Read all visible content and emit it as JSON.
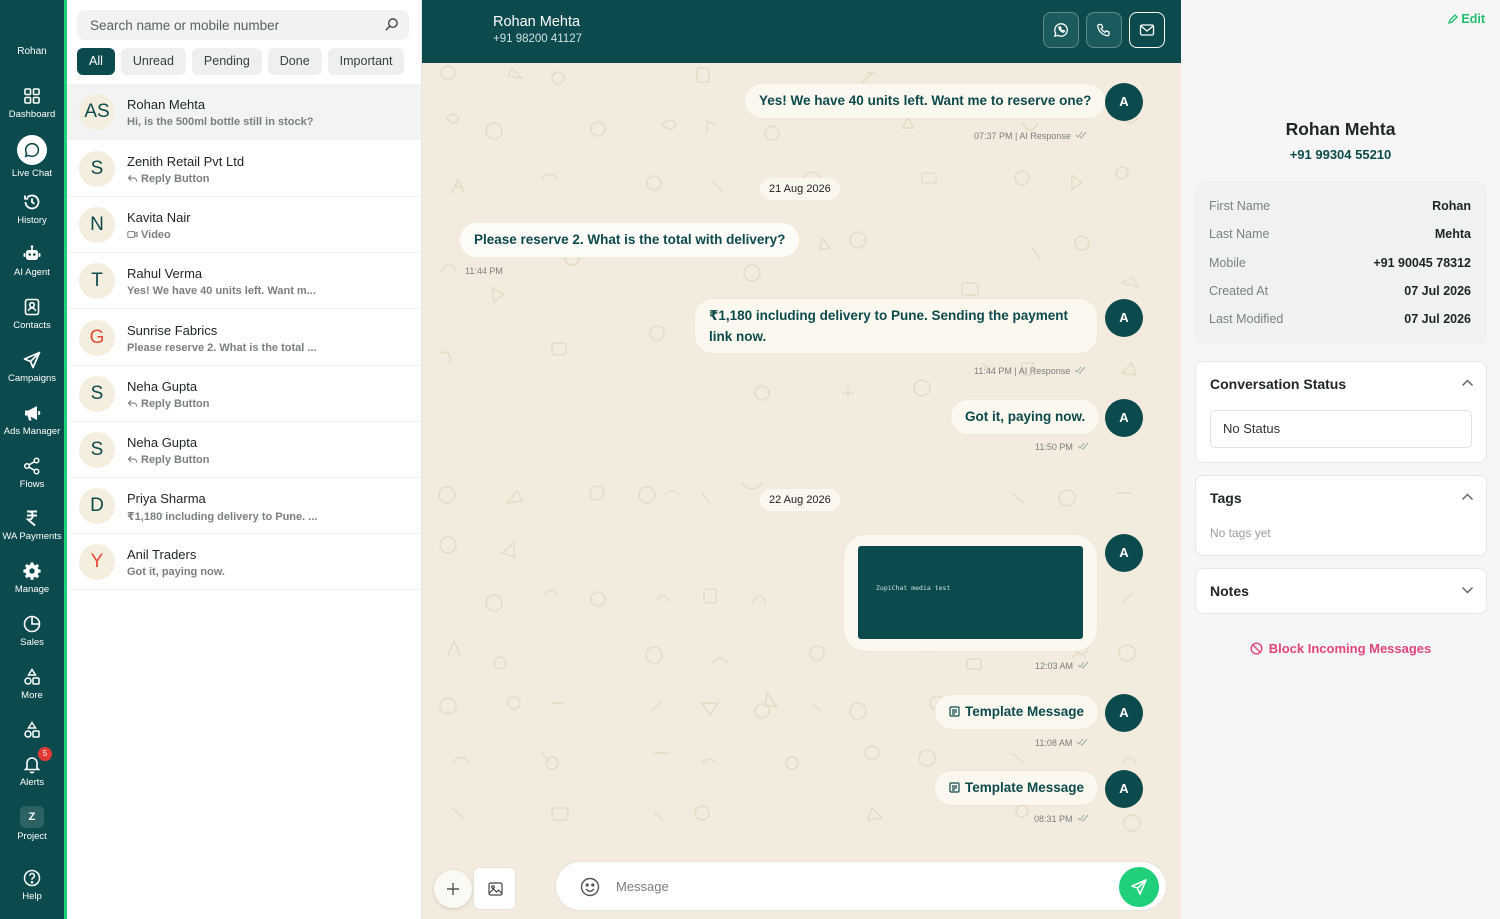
{
  "nav": {
    "user": "Rohan",
    "items": [
      {
        "label": "Dashboard",
        "icon": "dashboard-icon"
      },
      {
        "label": "Live Chat",
        "icon": "chat-icon"
      },
      {
        "label": "History",
        "icon": "history-icon"
      },
      {
        "label": "AI Agent",
        "icon": "robot-icon"
      },
      {
        "label": "Contacts",
        "icon": "contacts-icon"
      },
      {
        "label": "Campaigns",
        "icon": "send-icon"
      },
      {
        "label": "Ads Manager",
        "icon": "megaphone-icon"
      },
      {
        "label": "Flows",
        "icon": "share-icon"
      },
      {
        "label": "WA Payments",
        "icon": "rupee-icon"
      },
      {
        "label": "Manage",
        "icon": "gear-icon"
      },
      {
        "label": "Sales",
        "icon": "pie-icon"
      },
      {
        "label": "More",
        "icon": "shapes-icon"
      },
      {
        "label": "Alerts",
        "icon": "bell-icon"
      },
      {
        "label": "Project",
        "icon": "project-icon"
      },
      {
        "label": "Help",
        "icon": "help-icon"
      }
    ],
    "alerts_badge": "5",
    "project_letter": "Z"
  },
  "list": {
    "search_placeholder": "Search name or mobile number",
    "filters": [
      "All",
      "Unread",
      "Pending",
      "Done",
      "Important"
    ],
    "conversations": [
      {
        "avatar": "AS",
        "name": "Rohan Mehta",
        "preview": "Hi, is the 500ml bottle still in stock?"
      },
      {
        "avatar": "S",
        "name": "Zenith Retail Pvt Ltd",
        "preview": "Reply Button"
      },
      {
        "avatar": "N",
        "name": "Kavita Nair",
        "preview": "Video"
      },
      {
        "avatar": "T",
        "name": "Rahul Verma",
        "preview": "Yes! We have 40 units left. Want m..."
      },
      {
        "avatar": "G",
        "name": "Sunrise Fabrics",
        "preview": "Please reserve 2. What is the total ..."
      },
      {
        "avatar": "S",
        "name": "Neha Gupta",
        "preview": "Reply Button"
      },
      {
        "avatar": "S",
        "name": "Neha Gupta",
        "preview": "Reply Button"
      },
      {
        "avatar": "D",
        "name": "Priya Sharma",
        "preview": "₹1,180 including delivery to Pune. ..."
      },
      {
        "avatar": "Y",
        "name": "Anil Traders",
        "preview": "Got it, paying now."
      }
    ]
  },
  "chat": {
    "contact_name": "Rohan Mehta",
    "contact_phone": "+91 98200 41127",
    "messages": {
      "m1": {
        "text": "Yes! We have 40 units left. Want me to reserve one?",
        "meta": "07:37 PM | AI Response"
      },
      "d1": "21 Aug 2026",
      "m2": {
        "text": "Please reserve 2. What is the total with delivery?",
        "meta": "11:44 PM"
      },
      "m3": {
        "text": "₹1,180 including delivery to Pune. Sending the payment link now.",
        "meta": "11:44 PM | AI Response"
      },
      "m4": {
        "text": "Got it, paying now.",
        "meta": "11:50 PM"
      },
      "d2": "22 Aug 2026",
      "m5": {
        "media_text": "ZupiChat media test",
        "meta": "12:03 AM"
      },
      "m6": {
        "text": "Template Message",
        "meta": "11:08 AM"
      },
      "m7": {
        "text": "Template Message",
        "meta": "08:31 PM"
      }
    },
    "agent_initial": "A",
    "composer_placeholder": "Message"
  },
  "right": {
    "edit_label": "Edit",
    "name": "Rohan Mehta",
    "phone": "+91 99304 55210",
    "info": [
      {
        "k": "First Name",
        "v": "Rohan"
      },
      {
        "k": "Last Name",
        "v": "Mehta"
      },
      {
        "k": "Mobile",
        "v": "+91 90045 78312"
      },
      {
        "k": "Created At",
        "v": "07 Jul 2026"
      },
      {
        "k": "Last Modified",
        "v": "07 Jul 2026"
      }
    ],
    "conversation_status_title": "Conversation Status",
    "status_value": "No Status",
    "tags_title": "Tags",
    "tags_empty": "No tags yet",
    "notes_title": "Notes",
    "block_label": "Block Incoming Messages"
  },
  "colors": {
    "brand": "#0d4a4d",
    "accent_green": "#1fcf7a",
    "danger_pink": "#e0457b",
    "chat_bg": "#f3ecde"
  }
}
